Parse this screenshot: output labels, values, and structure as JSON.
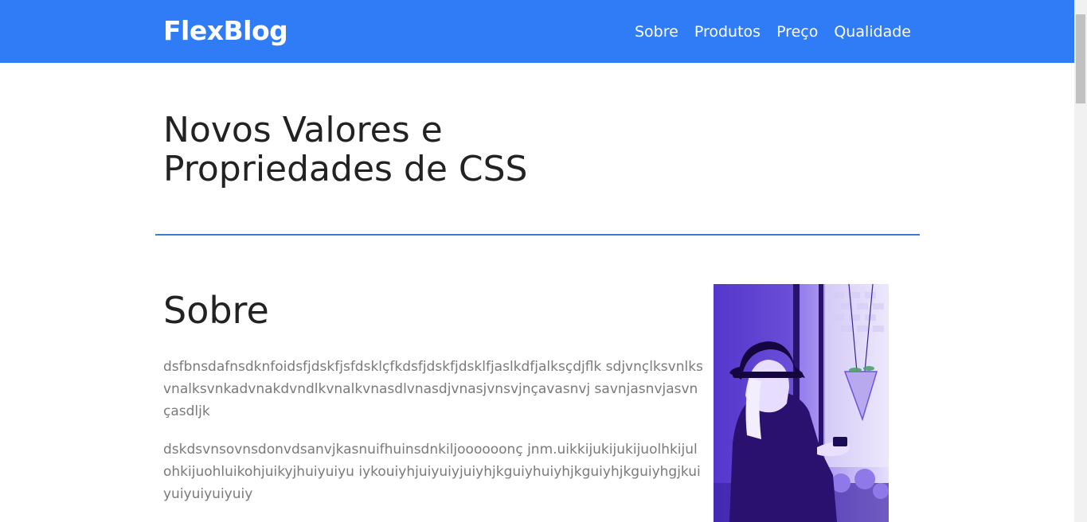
{
  "navbar": {
    "brand": "FlexBlog",
    "links": [
      "Sobre",
      "Produtos",
      "Preço",
      "Qualidade"
    ]
  },
  "hero": {
    "title": "Novos Valores e Propriedades de CSS"
  },
  "about": {
    "title": "Sobre",
    "paragraphs": [
      "dsfbnsdafnsdknfoidsfjdskfjsfdsklçfkdsfjdskfjdsklfjaslkdfjalksçdjflk sdjvnçlksvnlksvnalksvnkadvnakdvndlkvnalkvnasdlvnasdjvnasjvnsvjnçavasnvj savnjasnvjasvnçasdljk",
      "dskdsvnsovnsdonvdsanvjkasnuifhuinsdnkiljoooooonç jnm.uikkijukijukijuolhkijulohkijuohluikohjuikyjhuiyuiyu iykouiyhjuiyuiyjuiyhjkguiyhuiyhjkguiyhjkguiyhgjkuiyuiyuiyuiyuiy"
    ]
  },
  "colors": {
    "navbar_bg": "#2f7cf6",
    "divider": "#3c7ed0",
    "photo_tint": "#6b4fd6"
  }
}
